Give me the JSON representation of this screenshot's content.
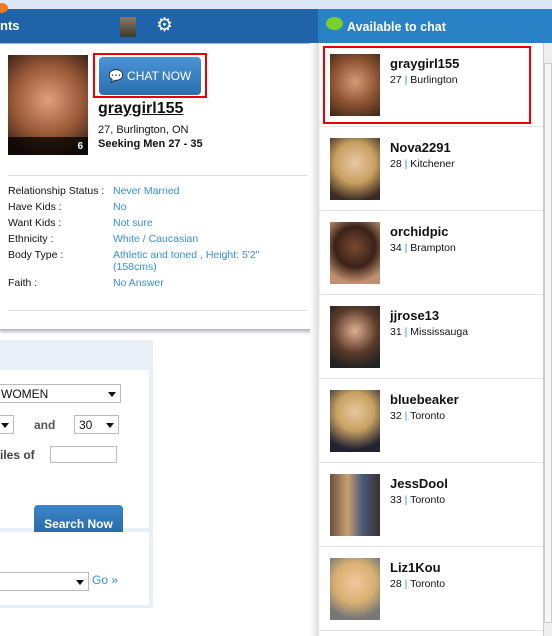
{
  "header": {
    "title_fragment": "nts"
  },
  "profile": {
    "username": "graygirl155",
    "location": "27, Burlington, ON",
    "seeking_label": "Seeking Men",
    "seeking_range": "27 - 35",
    "photo_count": "6",
    "chat_button": "CHAT NOW",
    "attributes": [
      {
        "label": "Relationship Status :",
        "value": "Never Married"
      },
      {
        "label": "Have Kids :",
        "value": "No"
      },
      {
        "label": "Want Kids :",
        "value": "Not sure"
      },
      {
        "label": "Ethnicity :",
        "value": "White / Caucasian"
      },
      {
        "label": "Body Type :",
        "value": "Athletic and toned , Height: 5'2\"(158cms)"
      },
      {
        "label": "Faith :",
        "value": "No Answer"
      }
    ]
  },
  "search": {
    "gender": "WOMEN",
    "and_label": "and",
    "age_max": "30",
    "miles_label": "iles of",
    "zip_value": "",
    "search_button": "Search Now",
    "go_link": "Go »"
  },
  "chat": {
    "title": "Available to chat",
    "users": [
      {
        "name": "graygirl155",
        "age": "27",
        "city": "Burlington"
      },
      {
        "name": "Nova2291",
        "age": "28",
        "city": "Kitchener"
      },
      {
        "name": "orchidpic",
        "age": "34",
        "city": "Brampton"
      },
      {
        "name": "jjrose13",
        "age": "31",
        "city": "Mississauga"
      },
      {
        "name": "bluebeaker",
        "age": "32",
        "city": "Toronto"
      },
      {
        "name": "JessDool",
        "age": "33",
        "city": "Toronto"
      },
      {
        "name": "Liz1Kou",
        "age": "28",
        "city": "Toronto"
      }
    ]
  },
  "colors": {
    "header": "#1f64a8",
    "chat_header": "#2a82c6",
    "link": "#3a8fd8",
    "highlight": "#ee0000"
  }
}
